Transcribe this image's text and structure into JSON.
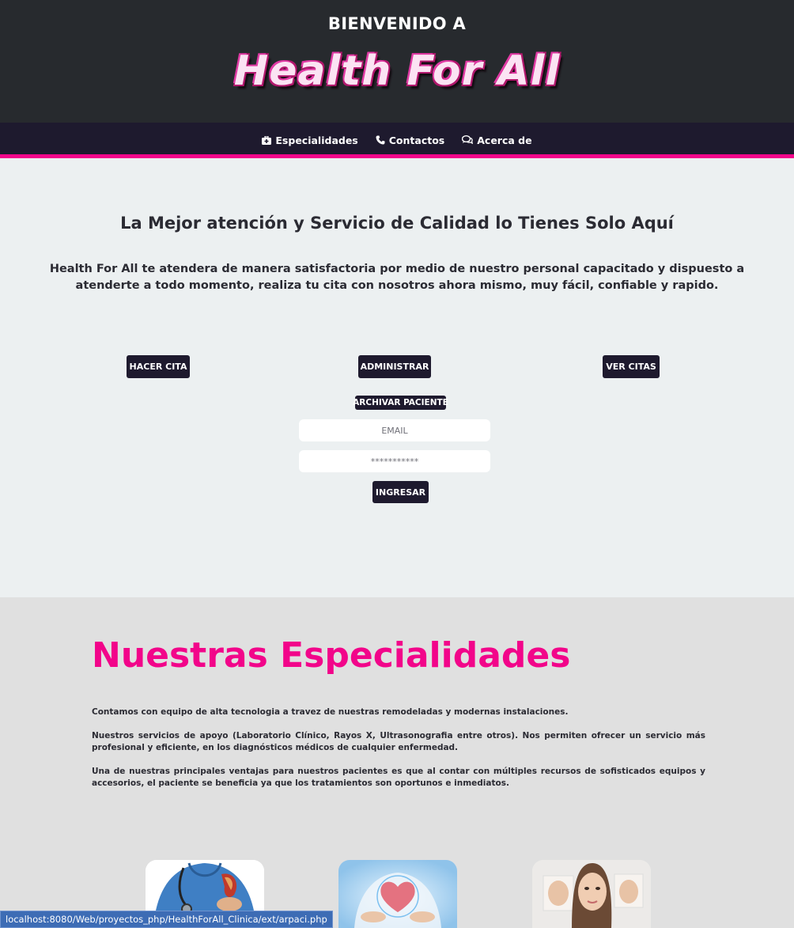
{
  "header": {
    "welcome": "BIENVENIDO A",
    "brand": "Health For All"
  },
  "nav": {
    "items": [
      {
        "label": "Especialidades",
        "icon": "medkit-icon"
      },
      {
        "label": "Contactos",
        "icon": "phone-icon"
      },
      {
        "label": "Acerca de",
        "icon": "comments-icon"
      }
    ]
  },
  "hero": {
    "title": "La Mejor atención y Servicio de Calidad lo Tienes Solo Aquí",
    "text": "Health For All te atendera de manera satisfactoria por medio de nuestro personal capacitado y dispuesto a atenderte a todo momento, realiza tu cita con nosotros ahora mismo, muy fácil, confiable y rapido."
  },
  "actions": {
    "hacer_cita": "HACER CITA",
    "administrar": "ADMINISTRAR",
    "ver_citas": "VER CITAS",
    "archivar_paciente": "ARCHIVAR PACIENTE"
  },
  "login": {
    "email_placeholder": "EMAIL",
    "password_placeholder": "***********",
    "submit": "INGRESAR"
  },
  "especialidades": {
    "title": "Nuestras Especialidades",
    "paragraphs": [
      "Contamos con equipo de alta tecnologia a travez de nuestras remodeladas y modernas instalaciones.",
      "Nuestros servicios de apoyo (Laboratorio Clínico, Rayos X, Ultrasonografia entre otros). Nos permiten ofrecer un servicio más profesional y eficiente, en los diagnósticos médicos de cualquier enfermedad.",
      "Una de nuestras principales ventajas para nuestros pacientes es que al contar con múltiples recursos de sofisticados equipos y accesorios, el paciente se beneficia ya que los tratamientos son oportunos e inmediatos."
    ]
  },
  "status_bar": {
    "url": "localhost:8080/Web/proyectos_php/HealthForAll_Clinica/ext/arpaci.php"
  },
  "colors": {
    "accent": "#f2058a",
    "header_bg": "#272a2e",
    "navbar_bg": "#1e1a2e",
    "button_bg": "#1e1a2e",
    "page_bg": "#ecf0f1",
    "section_bg": "#e0e0e0"
  }
}
